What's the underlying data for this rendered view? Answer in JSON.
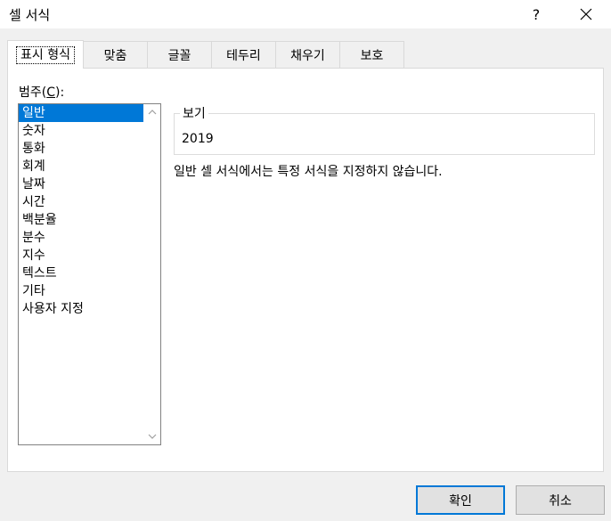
{
  "dialog": {
    "title": "셀 서식",
    "help_label": "?",
    "close_icon": "close-icon"
  },
  "tabs": [
    {
      "label": "표시 형식",
      "active": true
    },
    {
      "label": "맞춤",
      "active": false
    },
    {
      "label": "글꼴",
      "active": false
    },
    {
      "label": "테두리",
      "active": false
    },
    {
      "label": "채우기",
      "active": false
    },
    {
      "label": "보호",
      "active": false
    }
  ],
  "category": {
    "label_prefix": "범주(",
    "label_accel": "C",
    "label_suffix": "):",
    "items": [
      {
        "label": "일반",
        "selected": true
      },
      {
        "label": "숫자",
        "selected": false
      },
      {
        "label": "통화",
        "selected": false
      },
      {
        "label": "회계",
        "selected": false
      },
      {
        "label": "날짜",
        "selected": false
      },
      {
        "label": "시간",
        "selected": false
      },
      {
        "label": "백분율",
        "selected": false
      },
      {
        "label": "분수",
        "selected": false
      },
      {
        "label": "지수",
        "selected": false
      },
      {
        "label": "텍스트",
        "selected": false
      },
      {
        "label": "기타",
        "selected": false
      },
      {
        "label": "사용자 지정",
        "selected": false
      }
    ]
  },
  "preview": {
    "legend": "보기",
    "value": "2019"
  },
  "description": "일반 셀 서식에서는 특정 서식을 지정하지 않습니다.",
  "buttons": {
    "ok_label": "확인",
    "cancel_label": "취소"
  },
  "colors": {
    "selection": "#0078d7",
    "default_button_border": "#0078d7"
  }
}
